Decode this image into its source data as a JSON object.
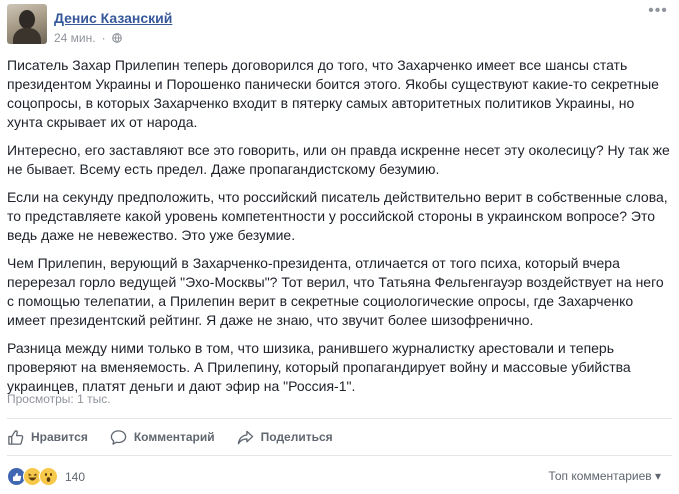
{
  "post": {
    "author": "Денис Казанский",
    "time": "24 мин.",
    "paragraphs": [
      "Писатель Захар Прилепин теперь договорился до того, что Захарченко имеет все шансы стать\nпрезидентом Украины и Порошенко панически боится этого. Якобы существуют какие-то секретные\nсоцопросы, в которых Захарченко входит в пятерку самых авторитетных политиков Украины, но\nхунта скрывает их от народа.",
      "Интересно, его заставляют все это говорить, или он правда искренне несет эту околесицу? Ну так же\nне бывает. Всему есть предел. Даже пропагандистскому безумию.",
      "Если на секунду предположить, что российский писатель действительно верит в собственные слова,\nто представляете какой уровень компетентности у российской стороны в украинском вопросе? Это\nведь даже не невежество. Это уже безумие.",
      "Чем Прилепин, верующий в Захарченко-президента, отличается от того психа, который вчера\nперерезал горло ведущей \"Эхо-Москвы\"? Тот верил, что Татьяна Фельгенгауэр воздействует на него\nс помощью телепатии, а Прилепин верит в секретные социологические опросы, где Захарченко\nимеет президентский рейтинг. Я даже не знаю, что звучит более шизофренично.",
      "Разница между ними только в том, что шизика, ранившего журналистку арестовали и теперь\nпроверяют на вменяемость. А Прилепину, который пропагандирует войну и массовые убийства\nукраинцев, платят деньги и дают эфир на \"Россия-1\"."
    ],
    "views": "Просмотры: 1 тыс."
  },
  "actions": {
    "like": "Нравится",
    "comment": "Комментарий",
    "share": "Поделиться"
  },
  "reactions": {
    "count": "140",
    "types": [
      "like-icon",
      "haha-icon",
      "wow-icon"
    ]
  },
  "comments_sort": "Топ комментариев ▾",
  "colors": {
    "link": "#365899",
    "text": "#1d2129",
    "muted": "#90949c",
    "like": "#4267b2"
  }
}
